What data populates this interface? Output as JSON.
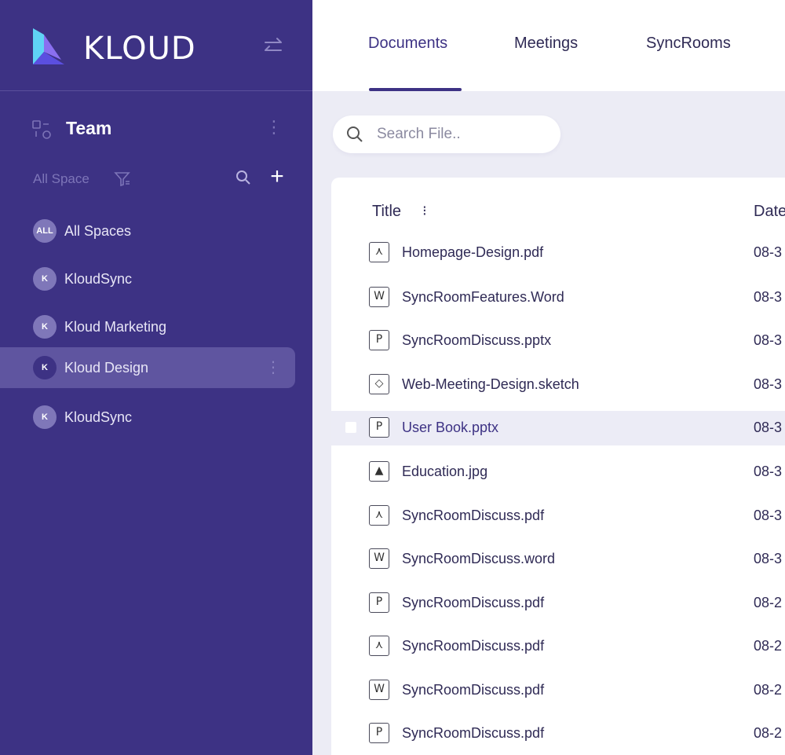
{
  "brand": {
    "name": "KLOUD",
    "colors": {
      "sidebar": "#3d3284",
      "accent": "#3d3284",
      "logo_light": "#5fd3f5",
      "logo_dark": "#5b4fe0"
    }
  },
  "team": {
    "title": "Team"
  },
  "space": {
    "label": "All Space"
  },
  "sidebar": {
    "items": [
      {
        "avatar": "ALL",
        "label": "All Spaces"
      },
      {
        "avatar": "K",
        "label": "KloudSync"
      },
      {
        "avatar": "K",
        "label": "Kloud Marketing"
      },
      {
        "avatar": "K",
        "label": "Kloud Design"
      },
      {
        "avatar": "K",
        "label": "KloudSync"
      }
    ]
  },
  "tabs": [
    {
      "label": "Documents"
    },
    {
      "label": "Meetings"
    },
    {
      "label": "SyncRooms"
    }
  ],
  "search": {
    "placeholder": "Search File.."
  },
  "table": {
    "headers": {
      "title": "Title",
      "date": "Date"
    },
    "rows": [
      {
        "icon": "pdf-icon",
        "glyph": "⋏",
        "name": "Homepage-Design.pdf",
        "date": "08-3"
      },
      {
        "icon": "word-icon",
        "glyph": "W",
        "name": "SyncRoomFeatures.Word",
        "date": "08-3"
      },
      {
        "icon": "ppt-icon",
        "glyph": "P",
        "name": "SyncRoomDiscuss.pptx",
        "date": "08-3"
      },
      {
        "icon": "sketch-icon",
        "glyph": "◇",
        "name": "Web-Meeting-Design.sketch",
        "date": "08-3"
      },
      {
        "icon": "ppt-icon",
        "glyph": "P",
        "name": "User Book.pptx",
        "date": "08-3"
      },
      {
        "icon": "image-icon",
        "glyph": "▲",
        "name": "Education.jpg",
        "date": "08-3"
      },
      {
        "icon": "pdf-icon",
        "glyph": "⋏",
        "name": "SyncRoomDiscuss.pdf",
        "date": "08-3"
      },
      {
        "icon": "word-icon",
        "glyph": "W",
        "name": "SyncRoomDiscuss.word",
        "date": "08-3"
      },
      {
        "icon": "ppt-icon",
        "glyph": "P",
        "name": "SyncRoomDiscuss.pdf",
        "date": "08-2"
      },
      {
        "icon": "pdf-icon",
        "glyph": "⋏",
        "name": "SyncRoomDiscuss.pdf",
        "date": "08-2"
      },
      {
        "icon": "word-icon",
        "glyph": "W",
        "name": "SyncRoomDiscuss.pdf",
        "date": "08-2"
      },
      {
        "icon": "ppt-icon",
        "glyph": "P",
        "name": "SyncRoomDiscuss.pdf",
        "date": "08-2"
      }
    ]
  }
}
